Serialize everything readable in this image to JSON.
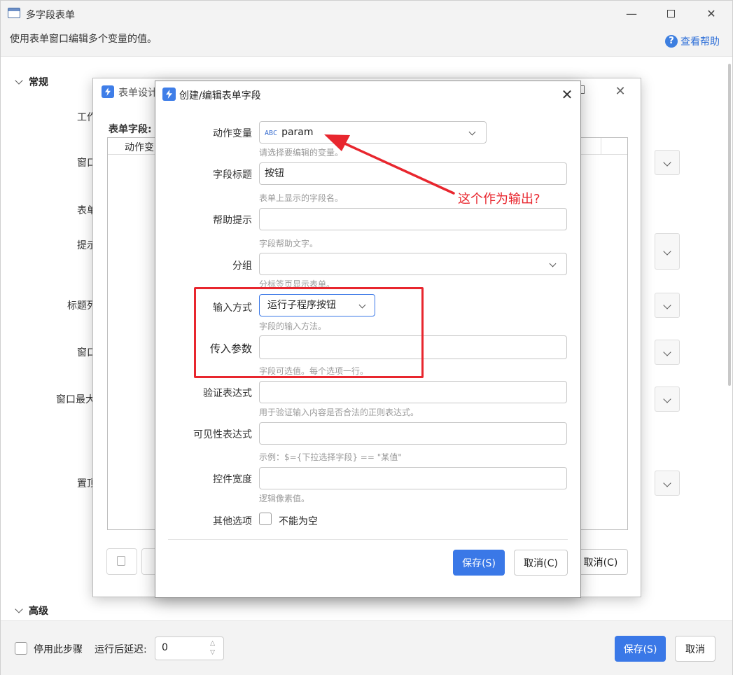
{
  "outer": {
    "title": "多字段表单",
    "description": "使用表单窗口编辑多个变量的值。",
    "help": "查看帮助",
    "section_general": "常规",
    "section_advanced": "高级",
    "left_labels": [
      "工作",
      "窗口",
      "表单",
      "提示",
      "标题列",
      "窗口",
      "窗口最大",
      "置顶"
    ],
    "bottom": {
      "disable_step": "停用此步骤",
      "delay_label": "运行后延迟:",
      "delay_value": "0",
      "save": "保存(S)",
      "cancel": "取消"
    }
  },
  "middle": {
    "title": "表单设计",
    "fields_label": "表单字段:",
    "column_name": "动作变",
    "cancel": "取消(C)"
  },
  "dialog": {
    "title": "创建/编辑表单字段",
    "rows": {
      "action_var": {
        "label": "动作变量",
        "value": "param",
        "type_badge": "ABC",
        "hint": "请选择要编辑的变量。"
      },
      "field_title": {
        "label": "字段标题",
        "value": "按钮",
        "hint": "表单上显示的字段名。"
      },
      "help_tip": {
        "label": "帮助提示",
        "value": "",
        "hint": "字段帮助文字。"
      },
      "group": {
        "label": "分组",
        "value": "",
        "hint": "分标签页显示表单。"
      },
      "input_mode": {
        "label": "输入方式",
        "value": "运行子程序按钮",
        "hint": "字段的输入方法。"
      },
      "pass_params": {
        "label": "传入参数",
        "value": "",
        "hint": "字段可选值。每个选项一行。"
      },
      "validate_expr": {
        "label": "验证表达式",
        "value": "",
        "hint": "用于验证输入内容是否合法的正则表达式。"
      },
      "visible_expr": {
        "label": "可见性表达式",
        "value": "",
        "hint": "示例：$={下拉选择字段} == \"某值\""
      },
      "control_width": {
        "label": "控件宽度",
        "value": "",
        "hint": "逻辑像素值。"
      },
      "other_options": {
        "label": "其他选项",
        "checkbox_label": "不能为空"
      }
    },
    "save": "保存(S)",
    "cancel": "取消(C)"
  },
  "annotation": {
    "text": "这个作为输出?",
    "color": "#e8262e"
  }
}
